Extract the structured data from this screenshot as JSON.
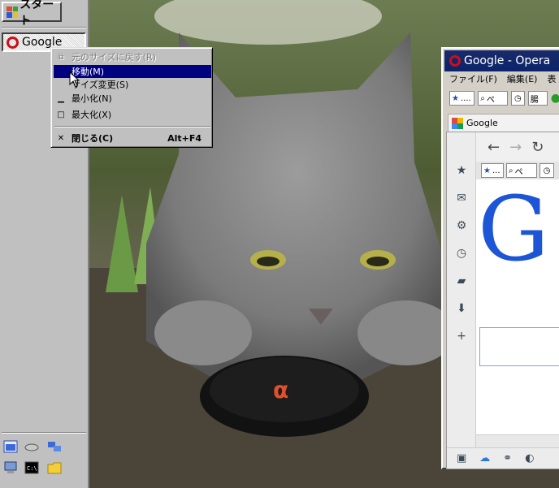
{
  "taskbar": {
    "start_label": "スタート",
    "task_google_label": "Google"
  },
  "context_menu": {
    "items": [
      {
        "icon": "restore-icon",
        "label": "元のサイズに戻す(R)",
        "accel": "",
        "state": "disabled"
      },
      {
        "icon": "",
        "label": "移動(M)",
        "accel": "",
        "state": "selected"
      },
      {
        "icon": "",
        "label": "サイズ変更(S)",
        "accel": "",
        "state": "normal"
      },
      {
        "icon": "minimize-icon",
        "label": "最小化(N)",
        "accel": "",
        "state": "normal"
      },
      {
        "icon": "maximize-icon",
        "label": "最大化(X)",
        "accel": "",
        "state": "normal"
      },
      {
        "icon": "close-icon",
        "label": "閉じる(C)",
        "accel": "Alt+F4",
        "state": "normal"
      }
    ]
  },
  "opera": {
    "title": "Google - Opera",
    "menubar": [
      "ファイル(F)",
      "編集(E)",
      "表"
    ],
    "toolbar_address": "....",
    "toolbar_search": "ペ",
    "toolbar_extra": "腸",
    "tab_label": "Google",
    "inner_toolbar_address": "...",
    "inner_toolbar_search": "ペ",
    "google_letter": "G"
  },
  "colors": {
    "taskbar": "#c0c0c0",
    "selection": "#000080",
    "opera_red": "#cc0f16",
    "google_blue": "#1c55d6"
  }
}
